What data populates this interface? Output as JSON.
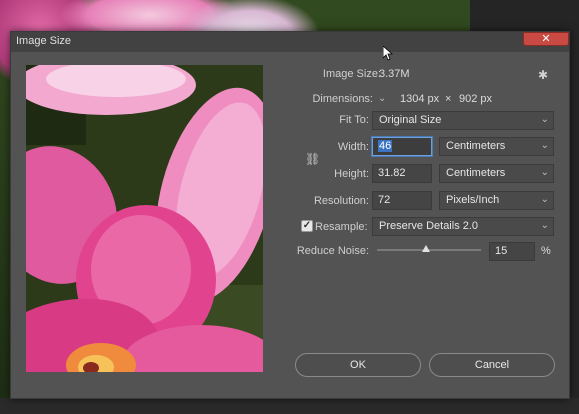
{
  "dialog": {
    "title": "Image Size",
    "close_label": "✕"
  },
  "info": {
    "image_size_label": "Image Size:",
    "image_size_value": "3.37M",
    "dimensions_label": "Dimensions:",
    "dimensions_width": "1304 px",
    "dimensions_sep": "×",
    "dimensions_height": "902 px"
  },
  "fit_to": {
    "label": "Fit To:",
    "value": "Original Size"
  },
  "width": {
    "label": "Width:",
    "value": "46",
    "unit": "Centimeters"
  },
  "height": {
    "label": "Height:",
    "value": "31.82",
    "unit": "Centimeters"
  },
  "resolution": {
    "label": "Resolution:",
    "value": "72",
    "unit": "Pixels/Inch"
  },
  "resample": {
    "label": "Resample:",
    "checked": true,
    "value": "Preserve Details 2.0"
  },
  "reduce_noise": {
    "label": "Reduce Noise:",
    "value": "15",
    "unit": "%",
    "level_percent": 15
  },
  "buttons": {
    "ok": "OK",
    "cancel": "Cancel"
  },
  "icons": {
    "gear": "gear-icon",
    "link": "link-chain-icon",
    "chevron": "chevron-down-icon"
  }
}
